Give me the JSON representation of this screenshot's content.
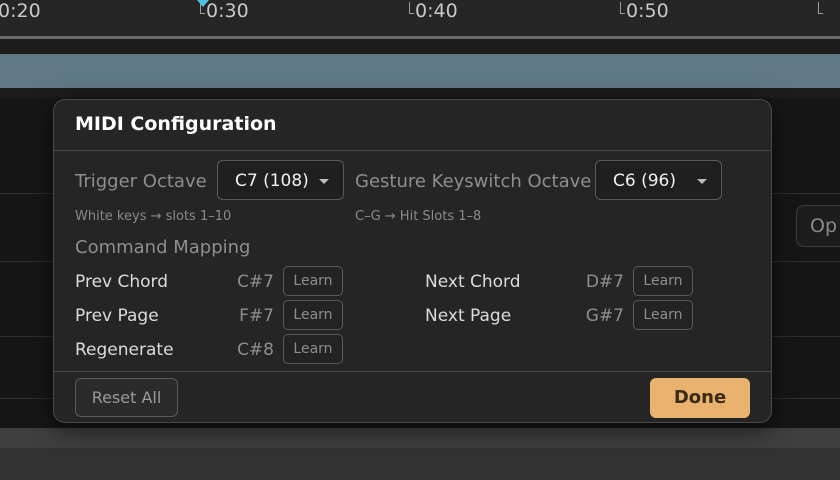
{
  "timeline": {
    "ticks": [
      "0:20",
      "0:30",
      "0:40",
      "0:50",
      ""
    ],
    "accent_color": "#4fc3e0",
    "clip_color": "#5f7a86"
  },
  "side_button_label": "Op",
  "dialog": {
    "title": "MIDI Configuration",
    "trigger_octave": {
      "label": "Trigger Octave",
      "value": "C7 (108)",
      "hint": "White keys → slots 1–10"
    },
    "gesture_octave": {
      "label": "Gesture Keyswitch Octave",
      "value": "C6 (96)",
      "hint": "C–G → Hit Slots 1–8"
    },
    "command_mapping": {
      "title": "Command Mapping",
      "learn_label": "Learn",
      "commands": [
        {
          "label": "Prev Chord",
          "note": "C#7"
        },
        {
          "label": "Next Chord",
          "note": "D#7"
        },
        {
          "label": "Prev Page",
          "note": "F#7"
        },
        {
          "label": "Next Page",
          "note": "G#7"
        },
        {
          "label": "Regenerate",
          "note": "C#8"
        }
      ]
    },
    "reset_label": "Reset All",
    "done_label": "Done",
    "done_color": "#e9b26e"
  }
}
